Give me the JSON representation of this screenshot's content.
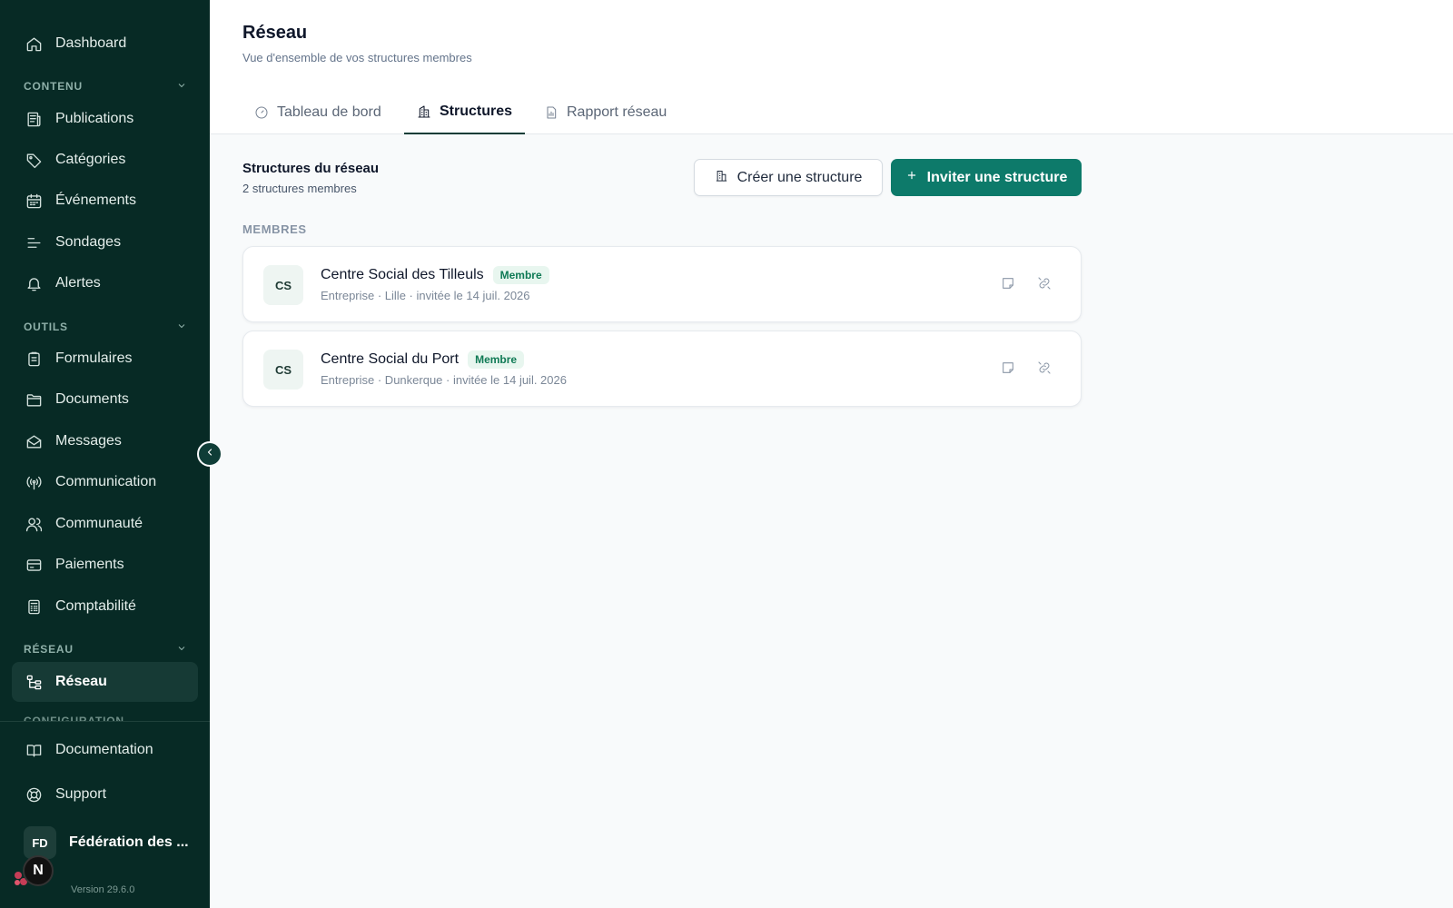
{
  "sidebar": {
    "dashboard": "Dashboard",
    "sections": {
      "contenu": "CONTENU",
      "outils": "OUTILS",
      "reseau": "RÉSEAU",
      "configuration_peek": "CONFIGURATION"
    },
    "items": {
      "publications": "Publications",
      "categories": "Catégories",
      "evenements": "Événements",
      "sondages": "Sondages",
      "alertes": "Alertes",
      "formulaires": "Formulaires",
      "documents": "Documents",
      "messages": "Messages",
      "communication": "Communication",
      "communaute": "Communauté",
      "paiements": "Paiements",
      "comptabilite": "Comptabilité",
      "reseau": "Réseau"
    },
    "footer": {
      "documentation": "Documentation",
      "support": "Support",
      "user_initials": "FD",
      "org_name": "Fédération des ...",
      "next_badge": "N",
      "version": "Version 29.6.0"
    }
  },
  "header": {
    "title": "Réseau",
    "subtitle": "Vue d'ensemble de vos structures membres",
    "tabs": [
      {
        "label": "Tableau de bord",
        "icon": "gauge-icon"
      },
      {
        "label": "Structures",
        "icon": "building-icon",
        "active": true
      },
      {
        "label": "Rapport réseau",
        "icon": "report-icon"
      }
    ]
  },
  "main": {
    "section_title": "Structures du réseau",
    "section_subtitle": "2 structures membres",
    "create_button": "Créer une structure",
    "invite_button": "Inviter une structure",
    "members_label": "MEMBRES",
    "members": [
      {
        "initials": "CS",
        "name": "Centre Social des Tilleuls",
        "badge": "Membre",
        "meta": "Entreprise · Lille · invitée le 14 juil. 2026"
      },
      {
        "initials": "CS",
        "name": "Centre Social du Port",
        "badge": "Membre",
        "meta": "Entreprise · Dunkerque · invitée le 14 juil. 2026"
      }
    ]
  },
  "colors": {
    "sidebar_bg": "#072a25",
    "primary": "#0d7a6a",
    "badge_text": "#0f7a55"
  }
}
